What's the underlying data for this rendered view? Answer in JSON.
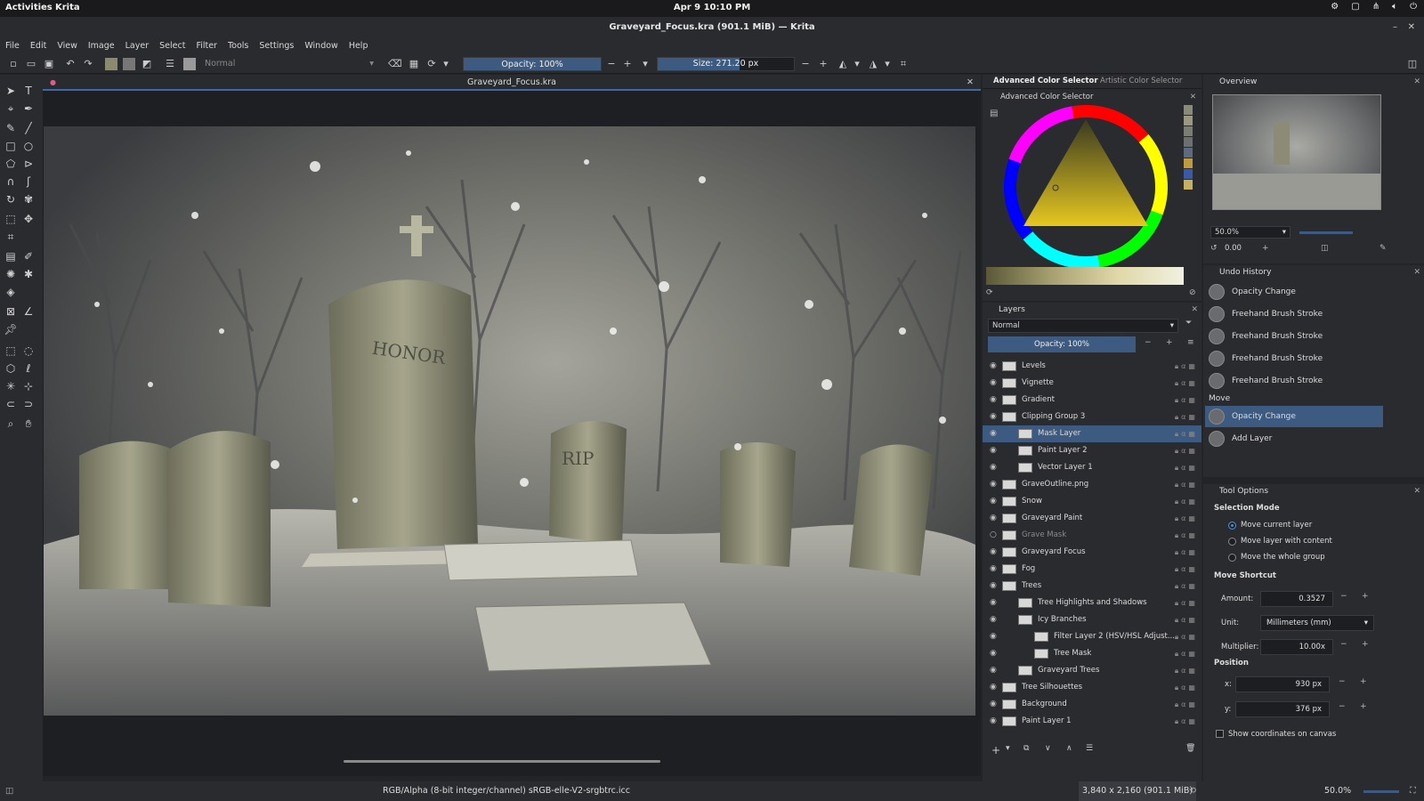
{
  "gnome": {
    "activities": "Activities",
    "app": "Krita",
    "clock": "Apr 9  10:10 PM"
  },
  "window": {
    "title": "Graveyard_Focus.kra (901.1 MiB) — Krita"
  },
  "menu": [
    "File",
    "Edit",
    "View",
    "Image",
    "Layer",
    "Select",
    "Filter",
    "Tools",
    "Settings",
    "Window",
    "Help"
  ],
  "toolbar": {
    "blend_mode": "Normal",
    "opacity_label": "Opacity: 100%",
    "size_label": "Size: 271.20 px",
    "opacity_value_percent": 100
  },
  "document": {
    "tab_title": "Graveyard_Focus.kra",
    "engraving_1": "HONOR",
    "engraving_2": "RIP"
  },
  "color_selector": {
    "tabs": [
      "Advanced Color Selector",
      "Artistic Color Selector"
    ],
    "dock_title": "Advanced Color Selector",
    "swatches": [
      "#8a8a78",
      "#9a9880",
      "#7a7d72",
      "#6c6f70",
      "#5e6a80",
      "#c09a40",
      "#3a5aa8",
      "#c4b060"
    ]
  },
  "layers": {
    "title": "Layers",
    "blend_mode": "Normal",
    "opacity_label": "Opacity:  100%",
    "items": [
      {
        "name": "Levels",
        "indent": 0,
        "visible": true,
        "selected": false
      },
      {
        "name": "Vignette",
        "indent": 0,
        "visible": true,
        "selected": false
      },
      {
        "name": "Gradient",
        "indent": 0,
        "visible": true,
        "selected": false
      },
      {
        "name": "Clipping Group 3",
        "indent": 0,
        "visible": true,
        "selected": false
      },
      {
        "name": "Mask Layer",
        "indent": 1,
        "visible": true,
        "selected": true
      },
      {
        "name": "Paint Layer 2",
        "indent": 1,
        "visible": true,
        "selected": false
      },
      {
        "name": "Vector Layer 1",
        "indent": 1,
        "visible": true,
        "selected": false
      },
      {
        "name": "GraveOutline.png",
        "indent": 0,
        "visible": true,
        "selected": false
      },
      {
        "name": "Snow",
        "indent": 0,
        "visible": true,
        "selected": false
      },
      {
        "name": "Graveyard Paint",
        "indent": 0,
        "visible": true,
        "selected": false
      },
      {
        "name": "Grave Mask",
        "indent": 0,
        "visible": false,
        "selected": false
      },
      {
        "name": "Graveyard Focus",
        "indent": 0,
        "visible": true,
        "selected": false
      },
      {
        "name": "Fog",
        "indent": 0,
        "visible": true,
        "selected": false
      },
      {
        "name": "Trees",
        "indent": 0,
        "visible": true,
        "selected": false
      },
      {
        "name": "Tree Highlights and Shadows",
        "indent": 1,
        "visible": true,
        "selected": false
      },
      {
        "name": "Icy Branches",
        "indent": 1,
        "visible": true,
        "selected": false
      },
      {
        "name": "Filter Layer 2 (HSV/HSL Adjust...",
        "indent": 2,
        "visible": true,
        "selected": false
      },
      {
        "name": "Tree Mask",
        "indent": 2,
        "visible": true,
        "selected": false
      },
      {
        "name": "Graveyard Trees",
        "indent": 1,
        "visible": true,
        "selected": false
      },
      {
        "name": "Tree Silhouettes",
        "indent": 0,
        "visible": true,
        "selected": false
      },
      {
        "name": "Background",
        "indent": 0,
        "visible": true,
        "selected": false
      },
      {
        "name": "Paint Layer 1",
        "indent": 0,
        "visible": true,
        "selected": false
      }
    ]
  },
  "overview": {
    "title": "Overview",
    "zoom": "50.0%",
    "rotation": "0.00"
  },
  "undo_history": {
    "title": "Undo History",
    "items": [
      {
        "label": "Opacity Change",
        "type": "entry",
        "selected": false
      },
      {
        "label": "Freehand Brush Stroke",
        "type": "entry",
        "selected": false
      },
      {
        "label": "Freehand Brush Stroke",
        "type": "entry",
        "selected": false
      },
      {
        "label": "Freehand Brush Stroke",
        "type": "entry",
        "selected": false
      },
      {
        "label": "Freehand Brush Stroke",
        "type": "entry",
        "selected": false
      },
      {
        "label": "Move",
        "type": "plain",
        "selected": false
      },
      {
        "label": "Opacity Change",
        "type": "entry",
        "selected": true
      },
      {
        "label": "Add Layer",
        "type": "entry",
        "selected": false
      }
    ]
  },
  "tool_options": {
    "title": "Tool Options",
    "selection_mode_heading": "Selection Mode",
    "radio_options": [
      "Move current layer",
      "Move layer with content",
      "Move the whole group"
    ],
    "selected_radio": 0,
    "move_shortcut_heading": "Move Shortcut",
    "amount_label": "Amount:",
    "amount_value": "0.3527",
    "unit_label": "Unit:",
    "unit_value": "Millimeters (mm)",
    "multiplier_label": "Multiplier:",
    "multiplier_value": "10.00x",
    "position_heading": "Position",
    "x_label": "x:",
    "x_value": "930 px",
    "y_label": "y:",
    "y_value": "376 px",
    "show_coords_label": "Show coordinates on canvas"
  },
  "status": {
    "color_profile": "RGB/Alpha (8-bit integer/channel)  sRGB-elle-V2-srgbtrc.icc",
    "dimensions": "3,840 x 2,160 (901.1 MiB)",
    "zoom": "50.0%"
  }
}
